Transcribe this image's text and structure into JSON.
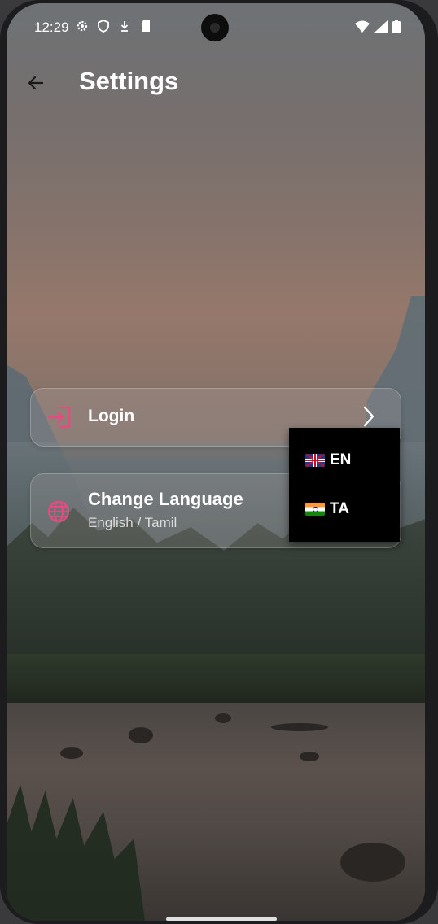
{
  "status_bar": {
    "time": "12:29",
    "left_icons": [
      "gear-icon",
      "shield-icon",
      "download-icon",
      "sd-card-icon"
    ],
    "right_icons": [
      "wifi-icon",
      "signal-icon",
      "battery-icon"
    ]
  },
  "app_bar": {
    "title": "Settings",
    "back_icon": "arrow-left-icon"
  },
  "settings": {
    "login": {
      "label": "Login",
      "icon": "login-icon",
      "icon_color": "#e84a7f"
    },
    "language": {
      "label": "Change Language",
      "subtitle": "English / Tamil",
      "icon": "globe-icon",
      "icon_color": "#e84a7f"
    }
  },
  "language_menu": {
    "options": [
      {
        "flag": "uk-flag-icon",
        "label": "EN"
      },
      {
        "flag": "india-flag-icon",
        "label": "TA"
      }
    ]
  }
}
